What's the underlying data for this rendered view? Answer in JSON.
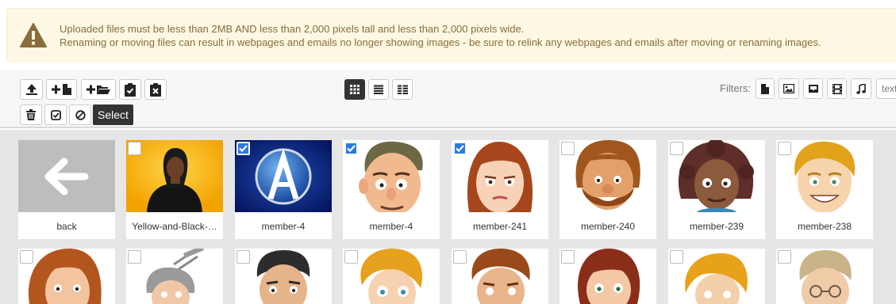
{
  "alert": {
    "line1": "Uploaded files must be less than 2MB AND less than 2,000 pixels tall and less than 2,000 pixels wide.",
    "line2": "Renaming or moving files can result in webpages and emails no longer showing images - be sure to relink any webpages and emails after moving or renaming images.",
    "icon": "warning-icon"
  },
  "toolbar": {
    "upload_icon": "upload-icon",
    "new_file_icon": "new-file-icon",
    "new_folder_icon": "new-folder-icon",
    "paste_icon": "clipboard-check-icon",
    "clear_clipboard_icon": "clipboard-x-icon",
    "delete_icon": "trash-icon",
    "select_all_icon": "check-square-icon",
    "deselect_icon": "ban-icon",
    "select_tooltip": "Select",
    "views": [
      "grid-view",
      "list-view",
      "detail-view"
    ],
    "active_view": "grid-view"
  },
  "filters": {
    "label": "Filters:",
    "types": [
      "file-icon",
      "image-icon",
      "archive-icon",
      "video-icon",
      "music-icon"
    ],
    "text_placeholder": "text"
  },
  "items_row1": [
    {
      "name": "back",
      "checked": false
    },
    {
      "name": "Yellow-and-Black-…",
      "checked": false
    },
    {
      "name": "member-4",
      "checked": true
    },
    {
      "name": "member-4",
      "checked": true
    },
    {
      "name": "member-241",
      "checked": true
    },
    {
      "name": "member-240",
      "checked": false
    },
    {
      "name": "member-239",
      "checked": false
    },
    {
      "name": "member-238",
      "checked": false
    }
  ],
  "colors": {
    "alert_bg": "#fcf8e3",
    "alert_text": "#8a6d3b",
    "checkbox_checked": "#2a7ae2",
    "grid_bg": "#e6e6e6"
  }
}
